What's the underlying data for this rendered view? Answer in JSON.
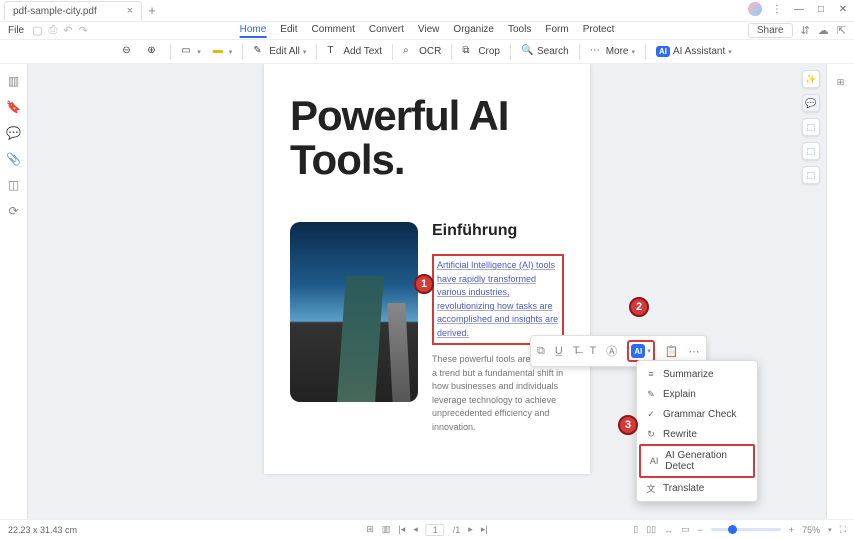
{
  "titlebar": {
    "tab_name": "pdf-sample-city.pdf",
    "tab_close": "×",
    "plus": "+",
    "win": {
      "min": "—",
      "max": "□",
      "close": "✕"
    }
  },
  "filerow": {
    "file_label": "File"
  },
  "menu": {
    "items": [
      "Home",
      "Edit",
      "Comment",
      "Convert",
      "View",
      "Organize",
      "Tools",
      "Form",
      "Protect"
    ],
    "active_index": 0,
    "share": "Share"
  },
  "toolbar": {
    "edit_all": "Edit All",
    "add_text": "Add Text",
    "ocr": "OCR",
    "crop": "Crop",
    "search": "Search",
    "more": "More",
    "ai_assistant": "AI Assistant"
  },
  "document": {
    "headline": "Powerful AI Tools.",
    "subhead": "Einführung",
    "highlighted_text": "Artificial Intelligence (AI) tools have rapidly transformed various industries, revolutionizing how tasks are accomplished and insights are derived.",
    "plain_text": "These powerful tools are not just a trend but a fundamental shift in how businesses and individuals leverage technology to achieve unprecedented efficiency and innovation."
  },
  "callouts": {
    "one": "1",
    "two": "2",
    "three": "3"
  },
  "dropdown": {
    "items": [
      {
        "label": "Summarize"
      },
      {
        "label": "Explain"
      },
      {
        "label": "Grammar Check"
      },
      {
        "label": "Rewrite"
      },
      {
        "label": "AI Generation Detect"
      },
      {
        "label": "Translate"
      }
    ],
    "highlight_index": 4
  },
  "status": {
    "dims": "22.23 x 31.43 cm",
    "page_current": "1",
    "page_total": "/1",
    "zoom": "75%"
  }
}
